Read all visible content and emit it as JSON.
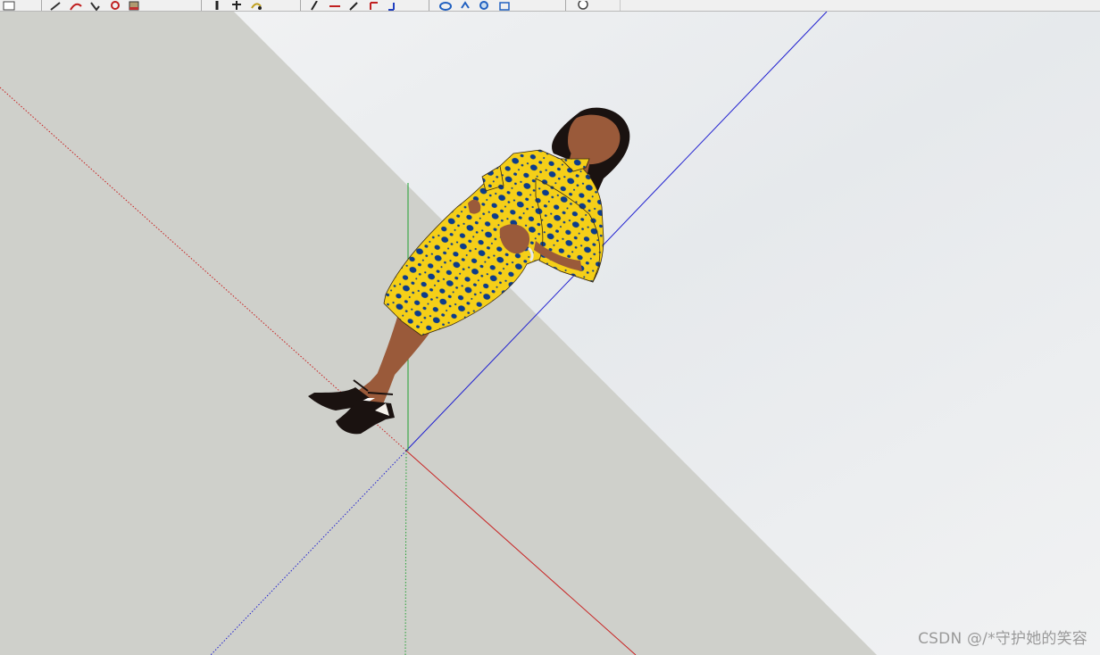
{
  "app": {
    "toolbar": {
      "buttons": [
        {
          "icon": "select-arrow-icon"
        },
        {
          "icon": "pencil-line-icon"
        },
        {
          "icon": "arc-icon"
        },
        {
          "icon": "freehand-icon"
        },
        {
          "icon": "eraser-icon"
        },
        {
          "icon": "paint-bucket-icon"
        },
        {
          "icon": "push-pull-icon"
        },
        {
          "icon": "move-icon"
        },
        {
          "icon": "rotate-icon"
        },
        {
          "icon": "scale-icon"
        },
        {
          "icon": "offset-icon"
        },
        {
          "icon": "tape-measure-icon"
        },
        {
          "icon": "dimension-icon"
        },
        {
          "icon": "protractor-icon"
        },
        {
          "icon": "text-icon"
        },
        {
          "icon": "axes-icon"
        },
        {
          "icon": "orbit-icon"
        },
        {
          "icon": "pan-icon"
        },
        {
          "icon": "zoom-icon"
        },
        {
          "icon": "zoom-extents-icon"
        },
        {
          "icon": "walk-icon"
        }
      ]
    },
    "viewport": {
      "sky_color": "#e8ebee",
      "ground_color": "#cfd0cb",
      "axis_colors": {
        "red": "#c82020",
        "green": "#20a030",
        "blue": "#2020d0"
      },
      "figure": {
        "dress_color": "#f5cf18",
        "dot_color": "#0c3c8c",
        "skin_color": "#9a5a3a",
        "hair_color": "#1a1210"
      }
    },
    "watermark": "CSDN @/*守护她的笑容"
  }
}
